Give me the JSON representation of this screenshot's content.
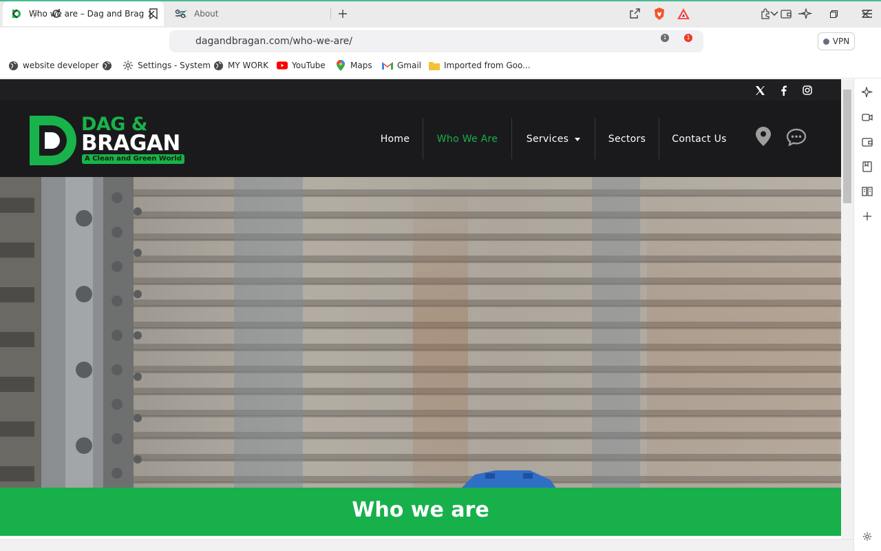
{
  "browser": {
    "tabs": [
      {
        "title": "Who we are – Dag and Bragan",
        "active": true
      },
      {
        "title": "About",
        "active": false
      }
    ],
    "url": "dagandbragan.com/who-we-are/",
    "brave_shields_count": "1",
    "rewards_count": "1",
    "vpn_label": "VPN",
    "accent_color": "#49b990"
  },
  "bookmarks": [
    {
      "label": "website developer",
      "icon": "globe-icon"
    },
    {
      "label": "",
      "icon": "globe-icon"
    },
    {
      "label": "Settings - System",
      "icon": "gear-icon"
    },
    {
      "label": "MY WORK",
      "icon": "globe-icon"
    },
    {
      "label": "YouTube",
      "icon": "youtube-icon"
    },
    {
      "label": "Maps",
      "icon": "maps-icon"
    },
    {
      "label": "Gmail",
      "icon": "gmail-icon"
    },
    {
      "label": "Imported from Goo...",
      "icon": "folder-icon"
    }
  ],
  "site": {
    "brand_line1": "DAG &",
    "brand_line2": "BRAGAN",
    "tagline": "A Clean and Green World",
    "brand_color": "#18b34a",
    "social": [
      "x-icon",
      "facebook-icon",
      "instagram-icon"
    ],
    "nav": [
      {
        "label": "Home",
        "active": false
      },
      {
        "label": "Who We Are",
        "active": true
      },
      {
        "label": "Services",
        "active": false,
        "dropdown": true
      },
      {
        "label": "Sectors",
        "active": false
      },
      {
        "label": "Contact Us",
        "active": false
      }
    ],
    "header_icons": [
      "location-pin-icon",
      "chat-bubble-icon"
    ],
    "page_heading": "Who we are"
  }
}
